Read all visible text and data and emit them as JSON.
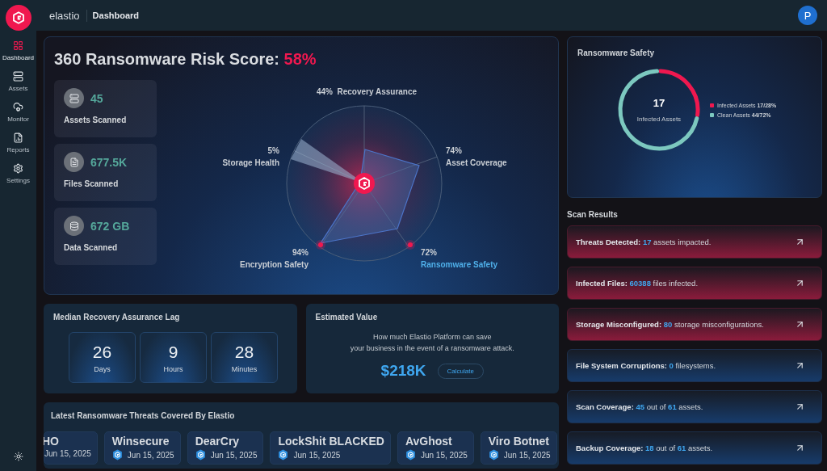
{
  "topbar": {
    "brand": "elastio",
    "page": "Dashboard",
    "avatar": "P"
  },
  "sidebar": {
    "items": [
      {
        "label": "Dashboard",
        "kind": "dashboard",
        "selected": true
      },
      {
        "label": "Assets",
        "kind": "assets",
        "selected": false
      },
      {
        "label": "Monitor",
        "kind": "monitor",
        "selected": false
      },
      {
        "label": "Reports",
        "kind": "reports",
        "selected": false
      },
      {
        "label": "Settings",
        "kind": "settings",
        "selected": false
      }
    ]
  },
  "risk": {
    "title": "360 Ransomware Risk Score:",
    "score": "58%",
    "stats": [
      {
        "value": "45",
        "label": "Assets Scanned",
        "kind": "server"
      },
      {
        "value": "677.5K",
        "label": "Files Scanned",
        "kind": "file"
      },
      {
        "value": "672 GB",
        "label": "Data Scanned",
        "kind": "database"
      }
    ],
    "axes": [
      {
        "reading": "44%",
        "label": "Recovery Assurance",
        "highlight": false
      },
      {
        "reading": "5%",
        "label": "Storage Health",
        "highlight": false
      },
      {
        "reading": "74%",
        "label": "Asset Coverage",
        "highlight": false
      },
      {
        "reading": "94%",
        "label": "Encryption Safety",
        "highlight": false
      },
      {
        "reading": "72%",
        "label": "Ransomware Safety",
        "highlight": true
      }
    ]
  },
  "lag": {
    "title": "Median Recovery Assurance Lag",
    "units": [
      {
        "value": "26",
        "label": "Days"
      },
      {
        "value": "9",
        "label": "Hours"
      },
      {
        "value": "28",
        "label": "Minutes"
      }
    ]
  },
  "estimate": {
    "title": "Estimated Value",
    "lines": [
      "How much Elastio Platform can save",
      "your business in the event of a ransomware attack."
    ],
    "value": "$218K",
    "button": "Calculate"
  },
  "threats": {
    "title": "Latest Ransomware Threats Covered By Elastio",
    "items": [
      {
        "name": "HO",
        "date": "Jun 15, 2025",
        "shield": false
      },
      {
        "name": "Winsecure",
        "date": "Jun 15, 2025",
        "shield": true
      },
      {
        "name": "DearCry",
        "date": "Jun 15, 2025",
        "shield": true
      },
      {
        "name": "LockShit BLACKED",
        "date": "Jun 15, 2025",
        "shield": true
      },
      {
        "name": "AvGhost",
        "date": "Jun 15, 2025",
        "shield": true
      },
      {
        "name": "Viro Botnet",
        "date": "Jun 15, 2025",
        "shield": true
      }
    ]
  },
  "safety": {
    "title": "Ransomware Safety",
    "center_value": "17",
    "center_label": "Infected Assets",
    "segments": [
      {
        "label": "Infected Assets",
        "reading": "17/28%",
        "color": "#f0184f"
      },
      {
        "label": "Clean Assets",
        "reading": "44/72%",
        "color": "#7cc8bf"
      }
    ]
  },
  "scan": {
    "title": "Scan Results",
    "items": [
      {
        "kind": "alert",
        "label": "Threats Detected:",
        "parts": [
          {
            "text": "17",
            "hl": true
          },
          {
            "text": " assets impacted.",
            "hl": false
          }
        ]
      },
      {
        "kind": "alert",
        "label": "Infected Files:",
        "parts": [
          {
            "text": "60388",
            "hl": true
          },
          {
            "text": " files infected.",
            "hl": false
          }
        ]
      },
      {
        "kind": "alert",
        "label": "Storage Misconfigured:",
        "parts": [
          {
            "text": "80",
            "hl": true
          },
          {
            "text": " storage misconfigurations.",
            "hl": false
          }
        ]
      },
      {
        "kind": "info",
        "label": "File System Corruptions:",
        "parts": [
          {
            "text": "0",
            "hl": true
          },
          {
            "text": " filesystems.",
            "hl": false
          }
        ]
      },
      {
        "kind": "info",
        "label": "Scan Coverage:",
        "parts": [
          {
            "text": "45",
            "hl": true
          },
          {
            "text": " out of ",
            "hl": false
          },
          {
            "text": "61",
            "hl": true
          },
          {
            "text": "  assets.",
            "hl": false
          }
        ]
      },
      {
        "kind": "info",
        "label": "Backup Coverage:",
        "parts": [
          {
            "text": "18",
            "hl": true
          },
          {
            "text": " out of ",
            "hl": false
          },
          {
            "text": "61",
            "hl": true
          },
          {
            "text": "  assets.",
            "hl": false
          }
        ]
      }
    ]
  }
}
